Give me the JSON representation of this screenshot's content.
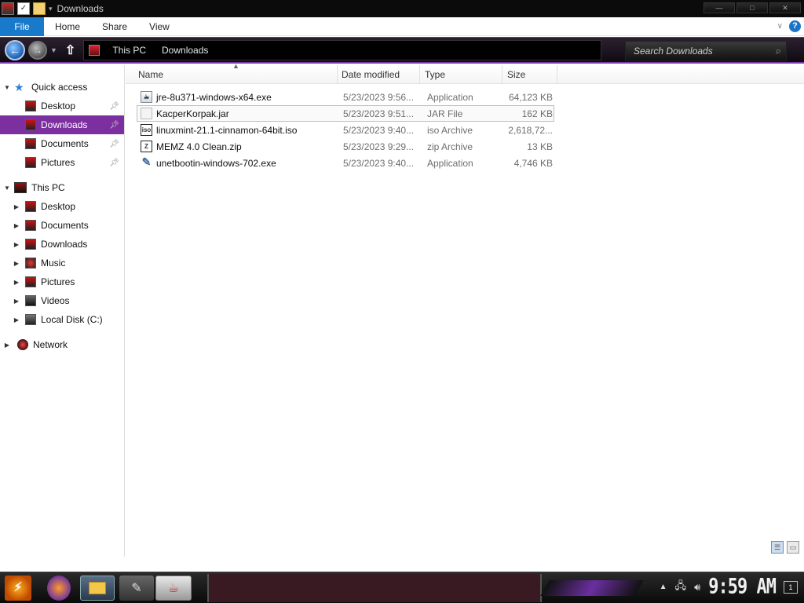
{
  "window": {
    "title": "Downloads",
    "minimize": "—",
    "maximize": "□",
    "close": "✕"
  },
  "ribbon": {
    "file": "File",
    "tabs": [
      "Home",
      "Share",
      "View"
    ],
    "help": "?"
  },
  "nav": {
    "breadcrumb": [
      "This PC",
      "Downloads"
    ],
    "search_placeholder": "Search Downloads"
  },
  "sidebar": {
    "quick_access": "Quick access",
    "quick_items": [
      "Desktop",
      "Downloads",
      "Documents",
      "Pictures"
    ],
    "this_pc": "This PC",
    "pc_items": [
      "Desktop",
      "Documents",
      "Downloads",
      "Music",
      "Pictures",
      "Videos",
      "Local Disk (C:)"
    ],
    "network": "Network",
    "selected": "Downloads"
  },
  "columns": [
    "Name",
    "Date modified",
    "Type",
    "Size"
  ],
  "files": [
    {
      "name": "jre-8u371-windows-x64.exe",
      "date": "5/23/2023 9:56...",
      "type": "Application",
      "size": "64,123 KB",
      "icon": "java-installer-icon"
    },
    {
      "name": "KacperKorpak.jar",
      "date": "5/23/2023 9:51...",
      "type": "JAR File",
      "size": "162 KB",
      "icon": "jar-file-icon"
    },
    {
      "name": "linuxmint-21.1-cinnamon-64bit.iso",
      "date": "5/23/2023 9:40...",
      "type": "iso Archive",
      "size": "2,618,72...",
      "icon": "iso-archive-icon"
    },
    {
      "name": "MEMZ 4.0 Clean.zip",
      "date": "5/23/2023 9:29...",
      "type": "zip Archive",
      "size": "13 KB",
      "icon": "zip-archive-icon"
    },
    {
      "name": "unetbootin-windows-702.exe",
      "date": "5/23/2023 9:40...",
      "type": "Application",
      "size": "4,746 KB",
      "icon": "usb-app-icon"
    }
  ],
  "taskbar": {
    "clock": "9:59 AM",
    "notifications": "1"
  }
}
